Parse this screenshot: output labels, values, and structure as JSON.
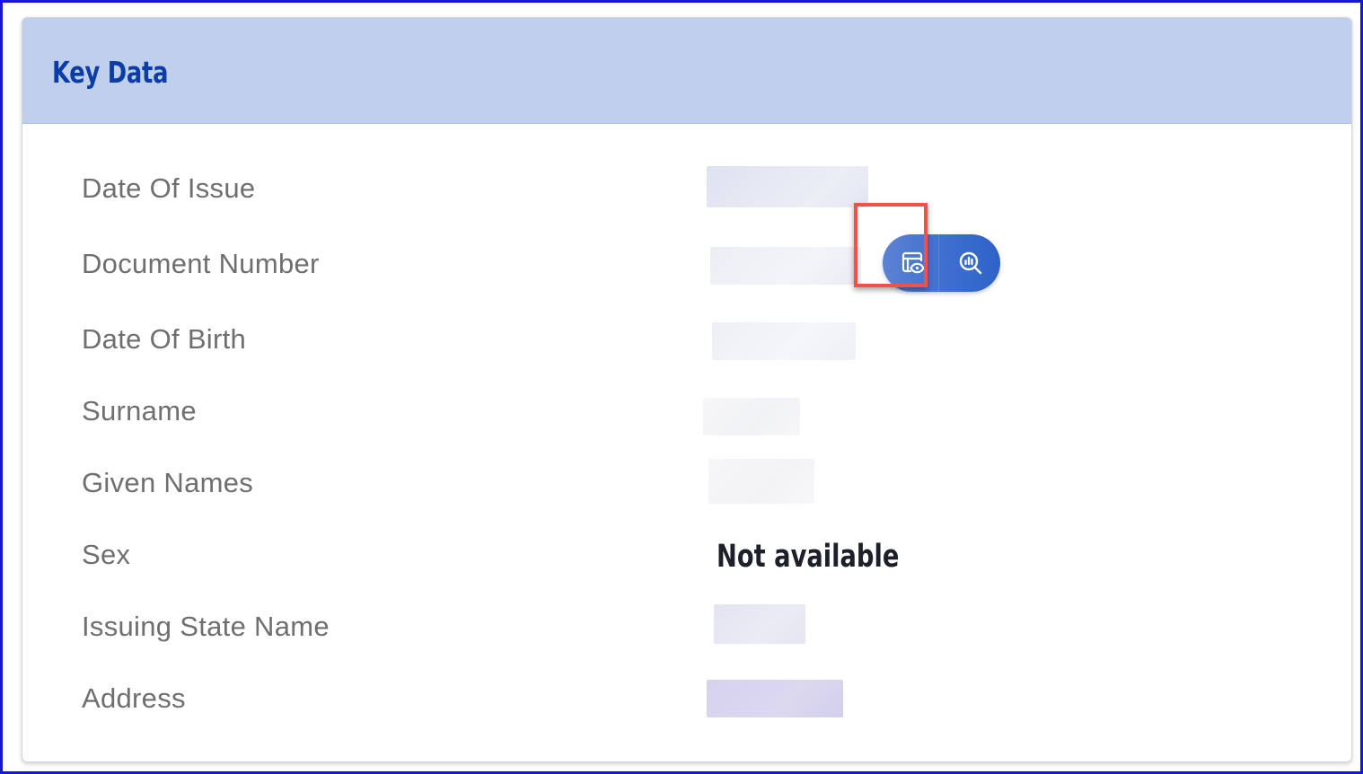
{
  "card": {
    "title": "Key Data"
  },
  "fields": [
    {
      "label": "Date Of Issue",
      "value": ""
    },
    {
      "label": "Document Number",
      "value": ""
    },
    {
      "label": "Date Of Birth",
      "value": ""
    },
    {
      "label": "Surname",
      "value": ""
    },
    {
      "label": "Given Names",
      "value": ""
    },
    {
      "label": "Sex",
      "value": "Not available"
    },
    {
      "label": "Issuing State Name",
      "value": ""
    },
    {
      "label": "Address",
      "value": ""
    }
  ],
  "actions": {
    "view_icon": "document-view-icon",
    "analyze_icon": "magnify-chart-icon"
  },
  "colors": {
    "frame": "#1a16d6",
    "header_bg": "#c0d0ec",
    "title": "#0c3ca6",
    "label": "#6f6f6f",
    "value": "#1d1f2a",
    "action_button": "#3d6fd0",
    "highlight": "#f25148"
  }
}
